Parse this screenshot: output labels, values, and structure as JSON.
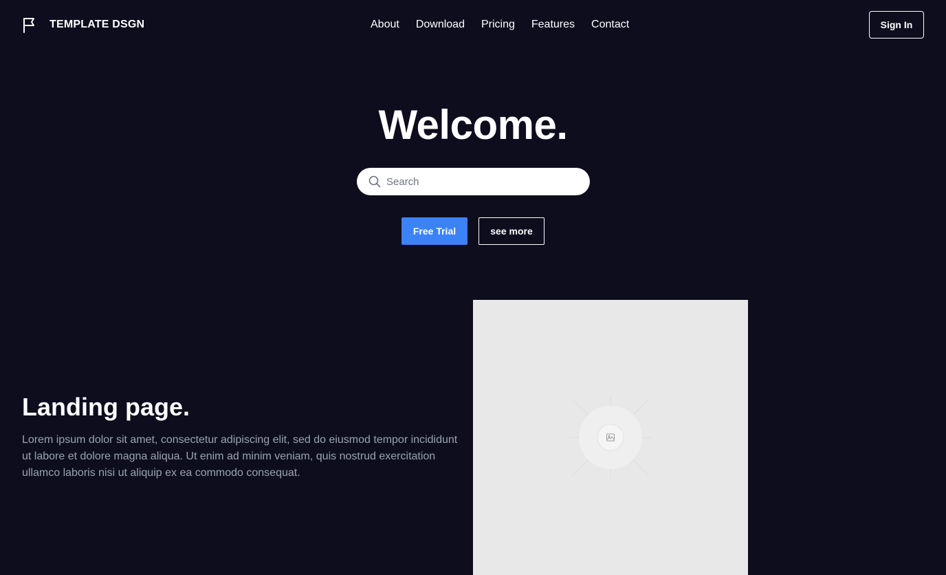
{
  "brand": {
    "icon": "flag-icon",
    "name": "TEMPLATE DSGN"
  },
  "nav": {
    "links": [
      "About",
      "Download",
      "Pricing",
      "Features",
      "Contact"
    ],
    "signin_label": "Sign In"
  },
  "hero": {
    "title": "Welcome.",
    "search_placeholder": "Search",
    "search_icon": "search-icon",
    "primary_label": "Free Trial",
    "secondary_label": "see more",
    "primary_color": "#3b82f6"
  },
  "feature": {
    "heading": "Landing page.",
    "text": "Lorem ipsum dolor sit amet, consectetur adipiscing elit, sed do eiusmod tempor incididunt ut labore et dolore magna aliqua. Ut enim ad minim veniam, quis nostrud exercitation ullamco laboris nisi ut aliquip ex ea commodo consequat.",
    "image_icon": "image-icon"
  },
  "colors": {
    "background": "#0d0d1e",
    "text_muted": "#9ca3af",
    "placeholder_bg": "#e8e8e8"
  }
}
